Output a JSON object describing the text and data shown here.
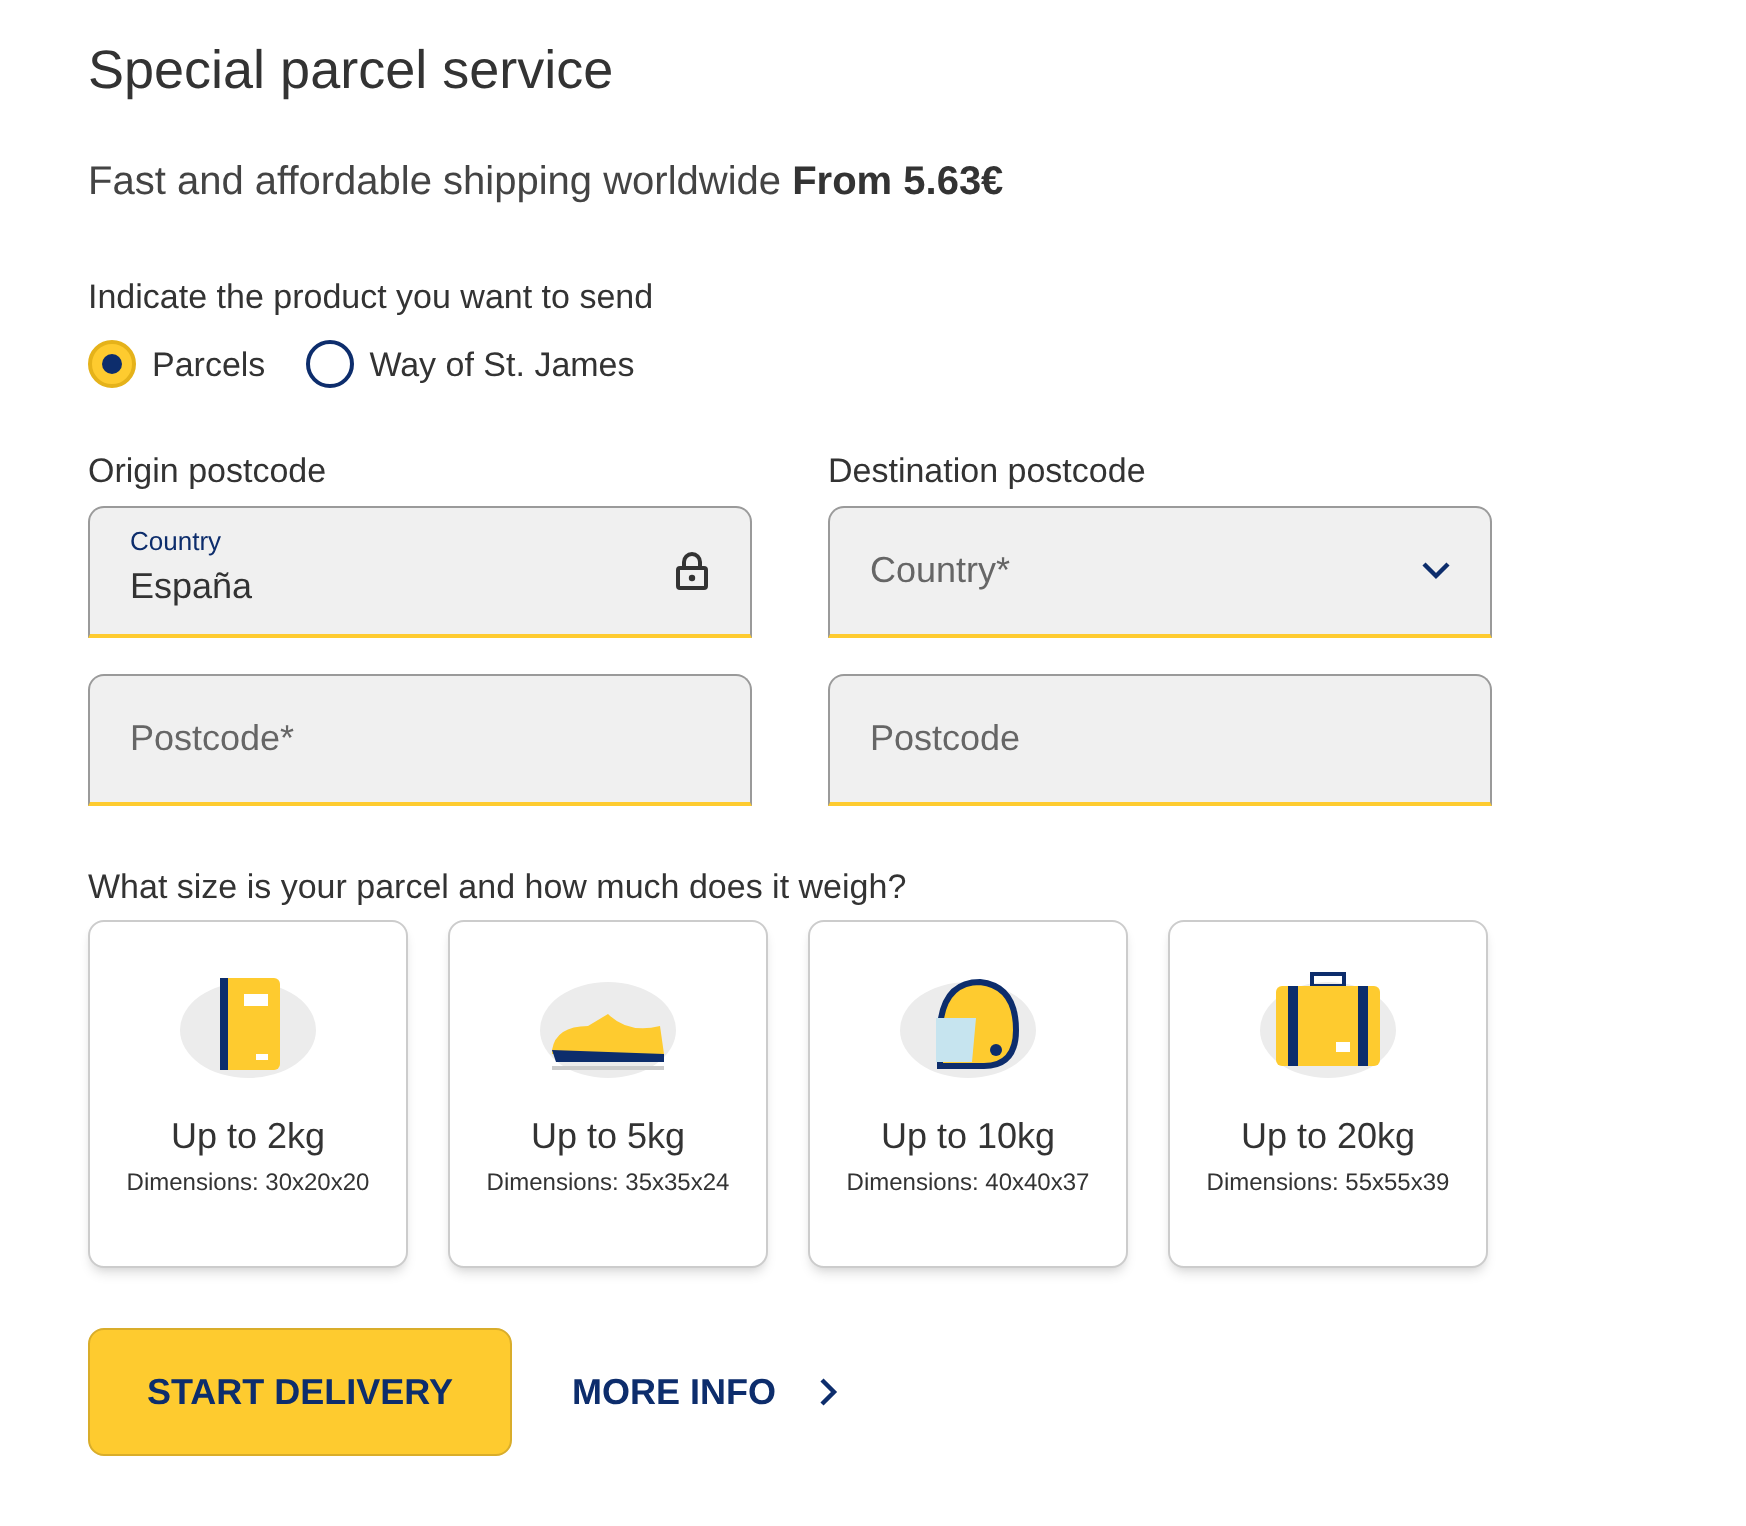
{
  "title": "Special parcel service",
  "subtitle": {
    "text": "Fast and affordable shipping worldwide",
    "price": "From 5.63€"
  },
  "product": {
    "label": "Indicate the product you want to send",
    "options": [
      {
        "label": "Parcels",
        "selected": true
      },
      {
        "label": "Way of St. James",
        "selected": false
      }
    ]
  },
  "columns": [
    {
      "label": "Origin postcode",
      "fields": [
        {
          "kind": "locked",
          "label": "Country",
          "value": "España"
        },
        {
          "kind": "text",
          "placeholder": "Postcode*"
        }
      ]
    },
    {
      "label": "Destination postcode",
      "fields": [
        {
          "kind": "select",
          "placeholder": "Country*"
        },
        {
          "kind": "text",
          "placeholder": "Postcode"
        }
      ]
    }
  ],
  "size_question": "What size is your parcel and how much does it weigh?",
  "sizes": [
    {
      "kind": "book",
      "title": "Up to 2kg",
      "dimensions": "Dimensions: 30x20x20"
    },
    {
      "kind": "shoe",
      "title": "Up to 5kg",
      "dimensions": "Dimensions: 35x35x24"
    },
    {
      "kind": "helmet",
      "title": "Up to 10kg",
      "dimensions": "Dimensions: 40x40x37"
    },
    {
      "kind": "suitcase",
      "title": "Up to 20kg",
      "dimensions": "Dimensions: 55x55x39"
    }
  ],
  "actions": {
    "primary": "START DELIVERY",
    "link": "MORE INFO"
  }
}
